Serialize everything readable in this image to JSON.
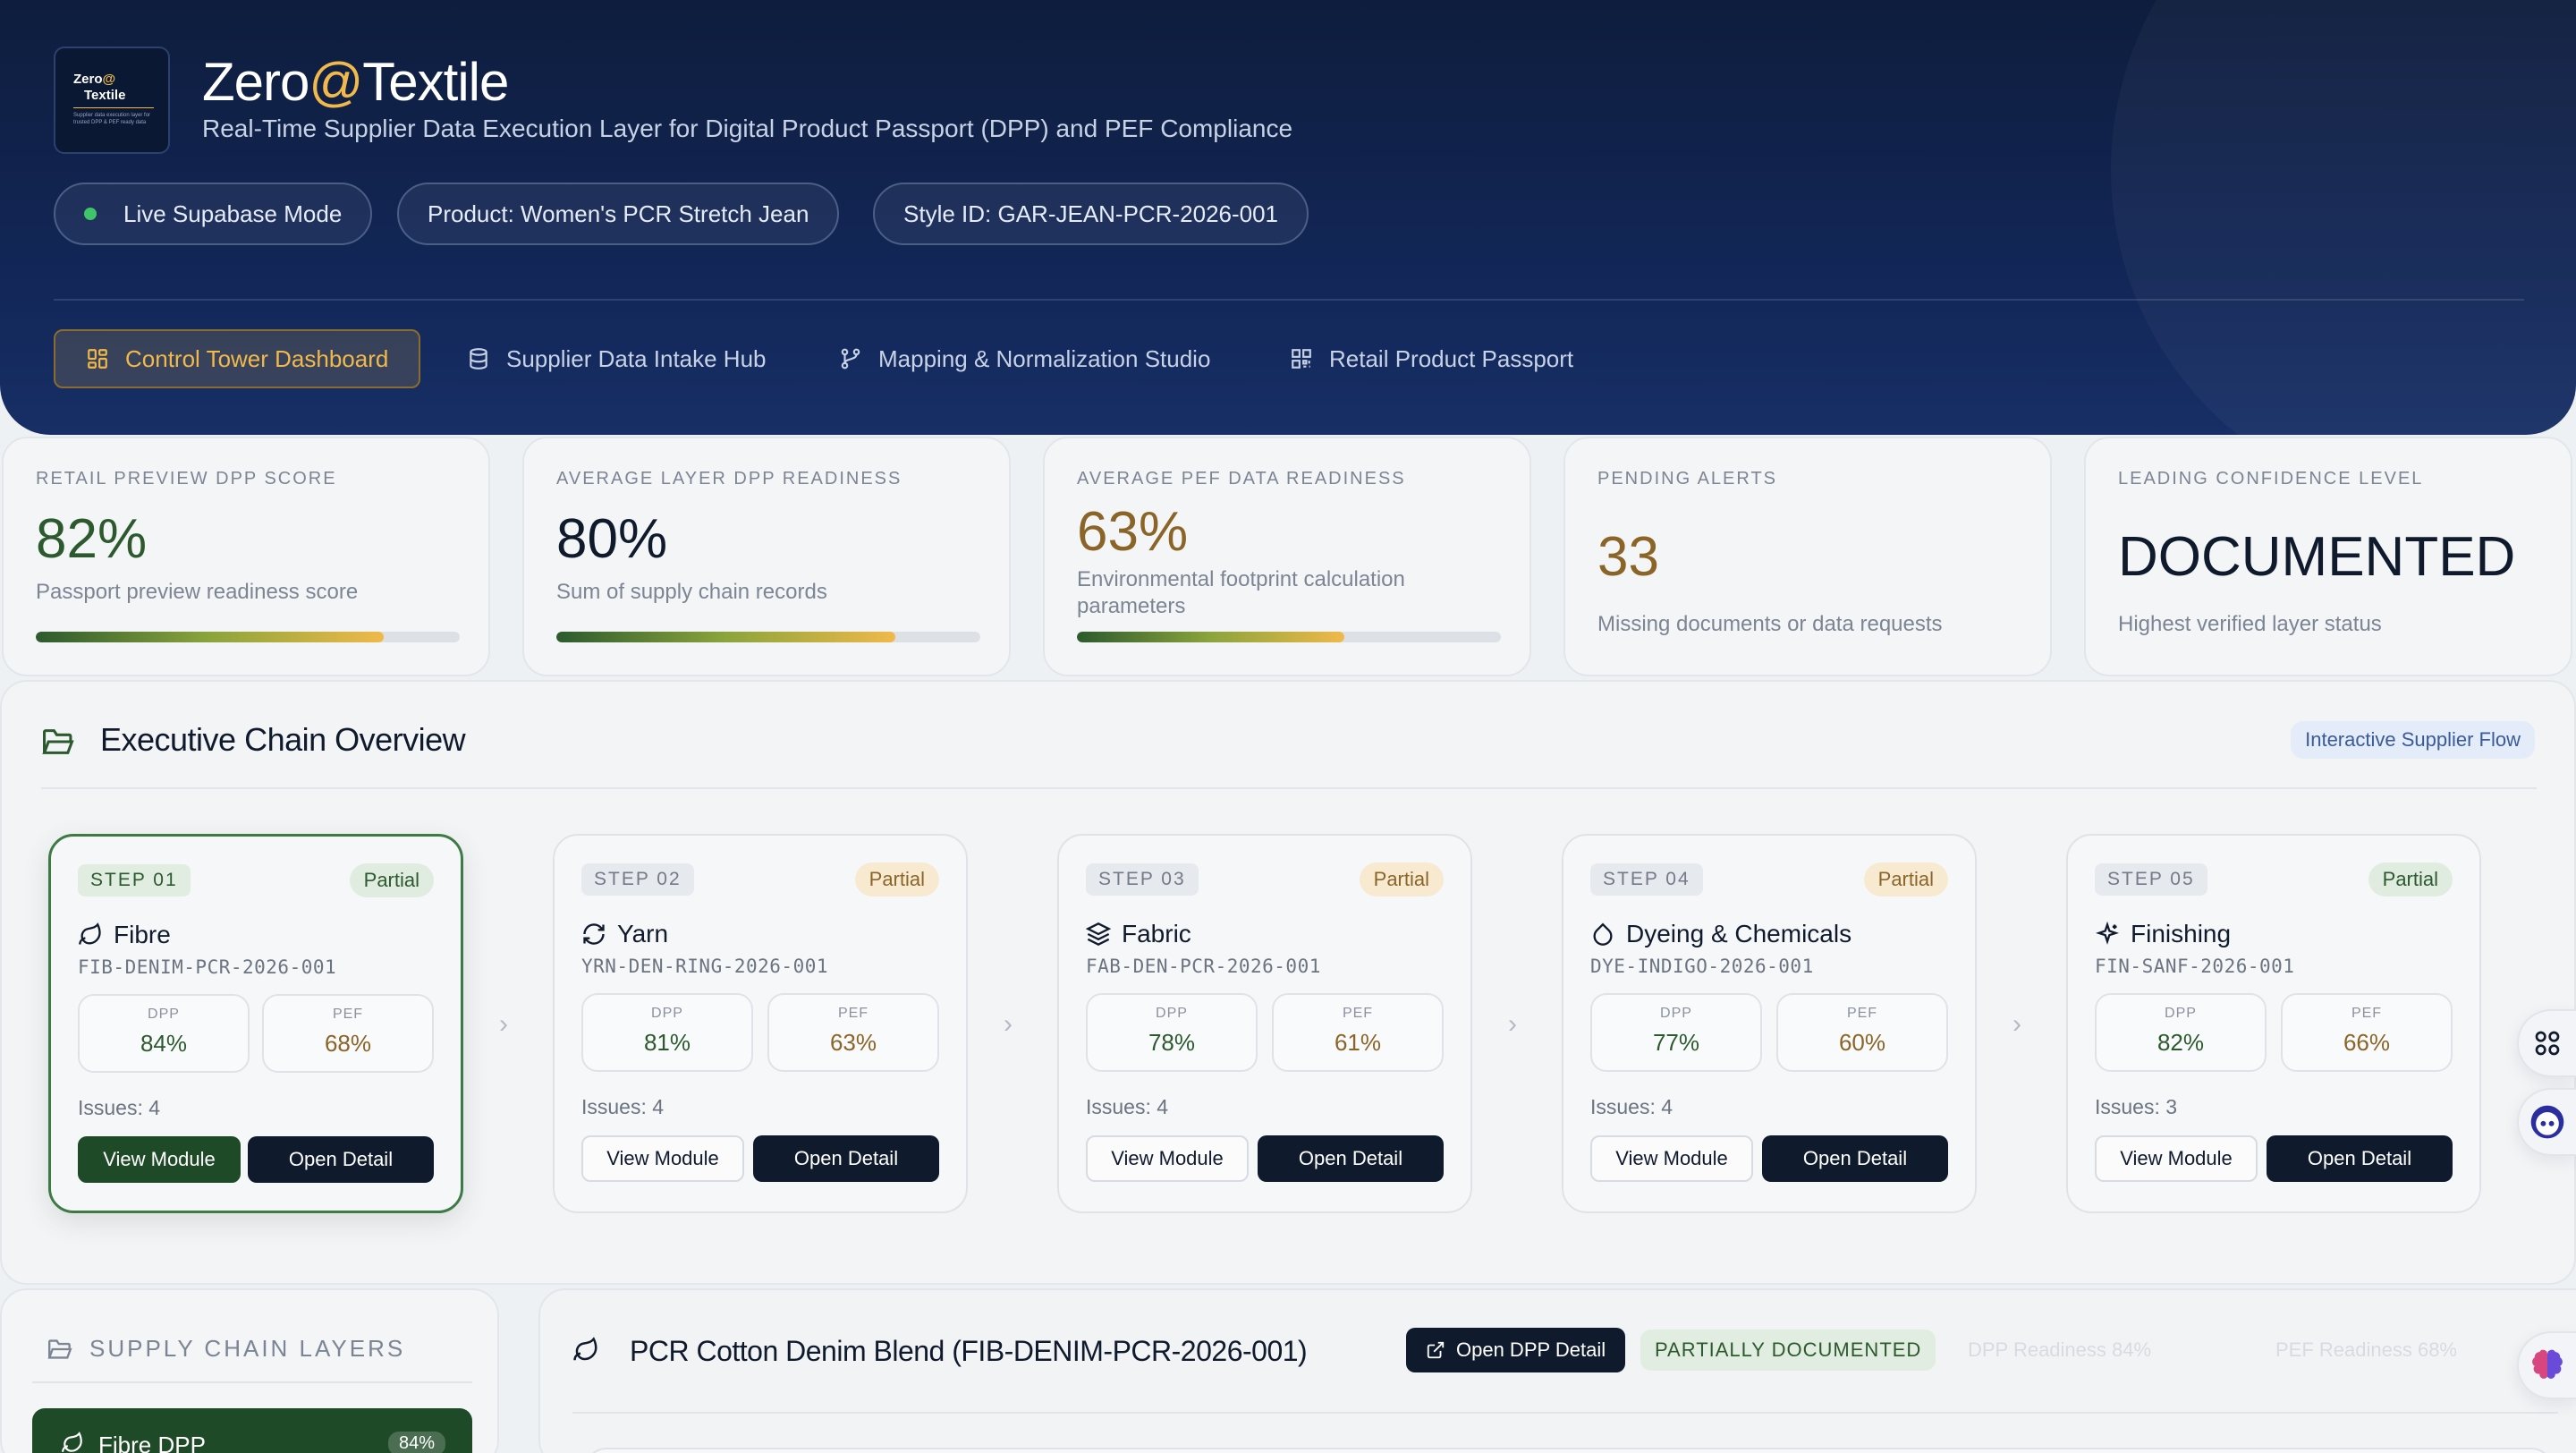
{
  "header": {
    "logo": {
      "line1_prefix": "Zero",
      "line1_at": "@",
      "line2": "Textile",
      "tagline": "Supplier data execution layer for trusted DPP & PEF ready data"
    },
    "title_prefix": "Zero",
    "title_at": "@",
    "title_suffix": "Textile",
    "subtitle": "Real-Time Supplier Data Execution Layer for Digital Product Passport (DPP) and PEF Compliance",
    "pills": [
      {
        "label": "Live Supabase Mode"
      },
      {
        "label": "Product: Women's PCR Stretch Jean"
      },
      {
        "label": "Style ID: GAR-JEAN-PCR-2026-001"
      }
    ],
    "nav": [
      {
        "label": "Control Tower Dashboard",
        "icon": "dashboard-icon",
        "active": true
      },
      {
        "label": "Supplier Data Intake Hub",
        "icon": "database-icon",
        "active": false
      },
      {
        "label": "Mapping & Normalization Studio",
        "icon": "branch-icon",
        "active": false
      },
      {
        "label": "Retail Product Passport",
        "icon": "qr-code-icon",
        "active": false
      }
    ]
  },
  "kpis": [
    {
      "label": "RETAIL PREVIEW DPP SCORE",
      "value": "82%",
      "desc": "Passport preview readiness score",
      "progress": 0.82,
      "value_color": "#2c5a2e"
    },
    {
      "label": "AVERAGE LAYER DPP READINESS",
      "value": "80%",
      "desc": "Sum of supply chain records",
      "progress": 0.8,
      "value_color": "#0f1b2d"
    },
    {
      "label": "AVERAGE PEF DATA READINESS",
      "value": "63%",
      "desc": "Environmental footprint calculation parameters",
      "progress": 0.63,
      "value_color": "#8a6527"
    },
    {
      "label": "PENDING ALERTS",
      "value": "33",
      "desc": "Missing documents or data requests",
      "value_color": "#8a6527"
    },
    {
      "label": "LEADING CONFIDENCE LEVEL",
      "value": "DOCUMENTED",
      "desc": "Highest verified layer status",
      "value_color": "#0f1b2d"
    }
  ],
  "exec": {
    "title": "Executive Chain Overview",
    "badge": "Interactive Supplier Flow",
    "steps": [
      {
        "step": "STEP 01",
        "status": "Partial",
        "status_tone": "green",
        "name": "Fibre",
        "icon": "leaf-icon",
        "code": "FIB-DENIM-PCR-2026-001",
        "dpp_label": "DPP",
        "dpp": "84%",
        "pef_label": "PEF",
        "pef": "68%",
        "issues": "Issues: 4",
        "view": "View Module",
        "open": "Open Detail"
      },
      {
        "step": "STEP 02",
        "status": "Partial",
        "status_tone": "amber",
        "name": "Yarn",
        "icon": "refresh-icon",
        "code": "YRN-DEN-RING-2026-001",
        "dpp_label": "DPP",
        "dpp": "81%",
        "pef_label": "PEF",
        "pef": "63%",
        "issues": "Issues: 4",
        "view": "View Module",
        "open": "Open Detail"
      },
      {
        "step": "STEP 03",
        "status": "Partial",
        "status_tone": "amber",
        "name": "Fabric",
        "icon": "layers-icon",
        "code": "FAB-DEN-PCR-2026-001",
        "dpp_label": "DPP",
        "dpp": "78%",
        "pef_label": "PEF",
        "pef": "61%",
        "issues": "Issues: 4",
        "view": "View Module",
        "open": "Open Detail"
      },
      {
        "step": "STEP 04",
        "status": "Partial",
        "status_tone": "amber",
        "name": "Dyeing & Chemicals",
        "icon": "droplet-icon",
        "code": "DYE-INDIGO-2026-001",
        "dpp_label": "DPP",
        "dpp": "77%",
        "pef_label": "PEF",
        "pef": "60%",
        "issues": "Issues: 4",
        "view": "View Module",
        "open": "Open Detail"
      },
      {
        "step": "STEP 05",
        "status": "Partial",
        "status_tone": "green",
        "name": "Finishing",
        "icon": "sparkles-icon",
        "code": "FIN-SANF-2026-001",
        "dpp_label": "DPP",
        "dpp": "82%",
        "pef_label": "PEF",
        "pef": "66%",
        "issues": "Issues: 3",
        "view": "View Module",
        "open": "Open Detail"
      }
    ]
  },
  "layers": {
    "title": "SUPPLY CHAIN LAYERS",
    "items": [
      {
        "label": "Fibre DPP",
        "pct": "84%"
      }
    ]
  },
  "detail": {
    "title": "PCR Cotton Denim Blend (FIB-DENIM-PCR-2026-001)",
    "open_button": "Open DPP Detail",
    "status": "PARTIALLY DOCUMENTED",
    "dpp_readiness": "DPP Readiness   84%",
    "pef_readiness": "PEF Readiness   68%"
  },
  "colors": {
    "brand_navy": "#13285a",
    "accent_gold": "#f0b94a",
    "forest_green": "#1f4a28"
  }
}
